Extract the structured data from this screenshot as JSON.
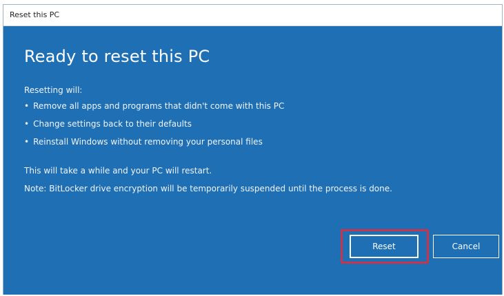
{
  "window": {
    "title": "Reset this PC"
  },
  "dialog": {
    "heading": "Ready to reset this PC",
    "intro": "Resetting will:",
    "bullets": [
      "Remove all apps and programs that didn't come with this PC",
      "Change settings back to their defaults",
      "Reinstall Windows without removing your personal files"
    ],
    "restart_note": "This will take a while and your PC will restart.",
    "bitlocker_note": "Note: BitLocker drive encryption will be temporarily suspended until the process is done."
  },
  "buttons": {
    "reset_label": "Reset",
    "cancel_label": "Cancel"
  },
  "colors": {
    "dialog_background": "#1f6fb5",
    "highlight_border": "#c8344b",
    "text": "#ffffff"
  }
}
